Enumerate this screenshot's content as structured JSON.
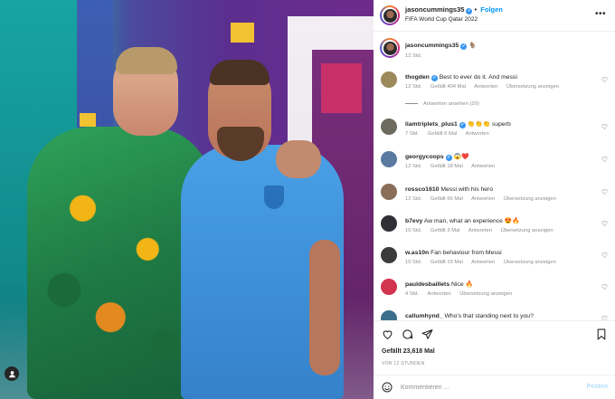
{
  "post": {
    "username": "jasoncummings35",
    "follow_label": "Folgen",
    "location": "FIFA World Cup Qatar 2022",
    "more_icon": "more-horizontal-icon",
    "caption_emoji": "🐐",
    "caption_time": "12 Std."
  },
  "comments": [
    {
      "user": "thogden",
      "verified": true,
      "text": "Best to ever do it. And messi",
      "time": "12 Std.",
      "likes": "Gefällt 404 Mal",
      "reply": "Antworten",
      "translate": "Übersetzung anzeigen",
      "view_replies": "Antworten ansehen (20)"
    },
    {
      "user": "liamtriplets_plus1",
      "verified": true,
      "text": "👏👏👏 superb",
      "time": "7 Std.",
      "likes": "Gefällt 6 Mal",
      "reply": "Antworten",
      "translate": ""
    },
    {
      "user": "georgycoops",
      "verified": true,
      "text": "😱❤️",
      "time": "12 Std.",
      "likes": "Gefällt 18 Mal",
      "reply": "Antworten",
      "translate": ""
    },
    {
      "user": "rossco1610",
      "verified": false,
      "text": "Messi with his hero",
      "time": "12 Std.",
      "likes": "Gefällt 66 Mal",
      "reply": "Antworten",
      "translate": "Übersetzung anzeigen"
    },
    {
      "user": "b7evy",
      "verified": false,
      "text": "Aw man, what an experience 😍🔥",
      "time": "10 Std.",
      "likes": "Gefällt 3 Mal",
      "reply": "Antworten",
      "translate": "Übersetzung anzeigen"
    },
    {
      "user": "w.as10n",
      "verified": false,
      "text": "Fan behaviour from Messi",
      "time": "10 Std.",
      "likes": "Gefällt 15 Mal",
      "reply": "Antworten",
      "translate": "Übersetzung anzeigen"
    },
    {
      "user": "pauldesbaillets",
      "verified": false,
      "text": "Nice 🔥",
      "time": "4 Std.",
      "likes": "",
      "reply": "Antworten",
      "translate": "Übersetzung anzeigen"
    },
    {
      "user": "callumhynd_",
      "verified": false,
      "text": "Who's that standing next to you?",
      "time": "",
      "likes": "",
      "reply": "",
      "translate": ""
    }
  ],
  "actions": {
    "like_icon": "heart-icon",
    "comment_icon": "comment-icon",
    "share_icon": "share-icon",
    "save_icon": "bookmark-icon",
    "likes_text": "Gefällt 23,618 Mal",
    "date_text": "VOR 12 STUNDEN"
  },
  "comment_box": {
    "emoji_icon": "emoji-icon",
    "placeholder": "Kommentieren ...",
    "post_label": "Posten"
  },
  "colors": {
    "accent": "#0095f6",
    "verified": "#3897f0",
    "muted": "#8e8e8e",
    "post_disabled": "#b2dffc"
  }
}
